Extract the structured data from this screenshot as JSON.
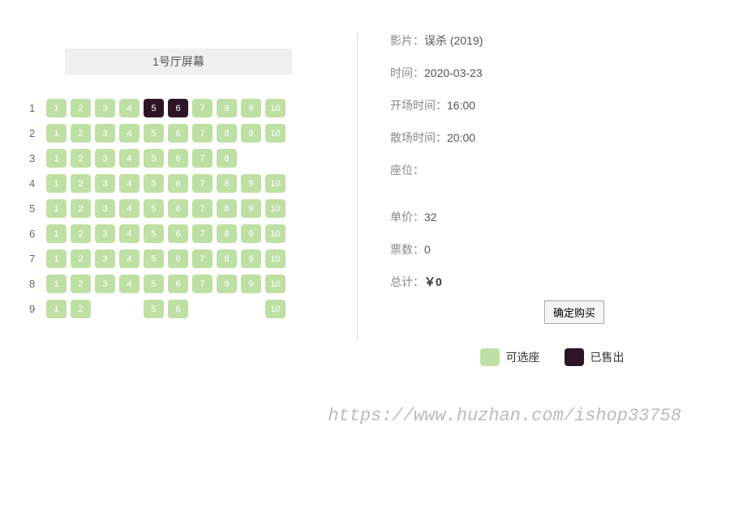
{
  "screen_label": "1号厅屏幕",
  "info": {
    "movie_label": "影片：",
    "movie_value": "误杀 (2019)",
    "date_label": "时间：",
    "date_value": "2020-03-23",
    "start_label": "开场时间：",
    "start_value": "16:00",
    "end_label": "散场时间：",
    "end_value": "20:00",
    "seat_label": "座位：",
    "seat_value": "",
    "price_label": "单价：",
    "price_value": "32",
    "count_label": "票数：",
    "count_value": "0",
    "total_label": "总计：",
    "total_value": "￥0"
  },
  "buy_button": "确定购买",
  "legend": {
    "available": "可选座",
    "sold": "已售出"
  },
  "watermark": "https://www.huzhan.com/ishop33758",
  "seat_rows": [
    {
      "row": 1,
      "seats": [
        1,
        2,
        3,
        4,
        "s5",
        "s6",
        7,
        8,
        9,
        10
      ]
    },
    {
      "row": 2,
      "seats": [
        1,
        2,
        3,
        4,
        5,
        6,
        7,
        8,
        9,
        10
      ]
    },
    {
      "row": 3,
      "seats": [
        1,
        2,
        3,
        4,
        5,
        6,
        7,
        8,
        null,
        null
      ]
    },
    {
      "row": 4,
      "seats": [
        1,
        2,
        3,
        4,
        5,
        6,
        7,
        8,
        9,
        10
      ]
    },
    {
      "row": 5,
      "seats": [
        1,
        2,
        3,
        4,
        5,
        6,
        7,
        8,
        9,
        10
      ]
    },
    {
      "row": 6,
      "seats": [
        1,
        2,
        3,
        4,
        5,
        6,
        7,
        8,
        9,
        10
      ]
    },
    {
      "row": 7,
      "seats": [
        1,
        2,
        3,
        4,
        5,
        6,
        7,
        8,
        9,
        10
      ]
    },
    {
      "row": 8,
      "seats": [
        1,
        2,
        3,
        4,
        5,
        6,
        7,
        8,
        9,
        10
      ]
    },
    {
      "row": 9,
      "seats": [
        1,
        2,
        null,
        null,
        5,
        6,
        null,
        null,
        null,
        10
      ]
    }
  ]
}
